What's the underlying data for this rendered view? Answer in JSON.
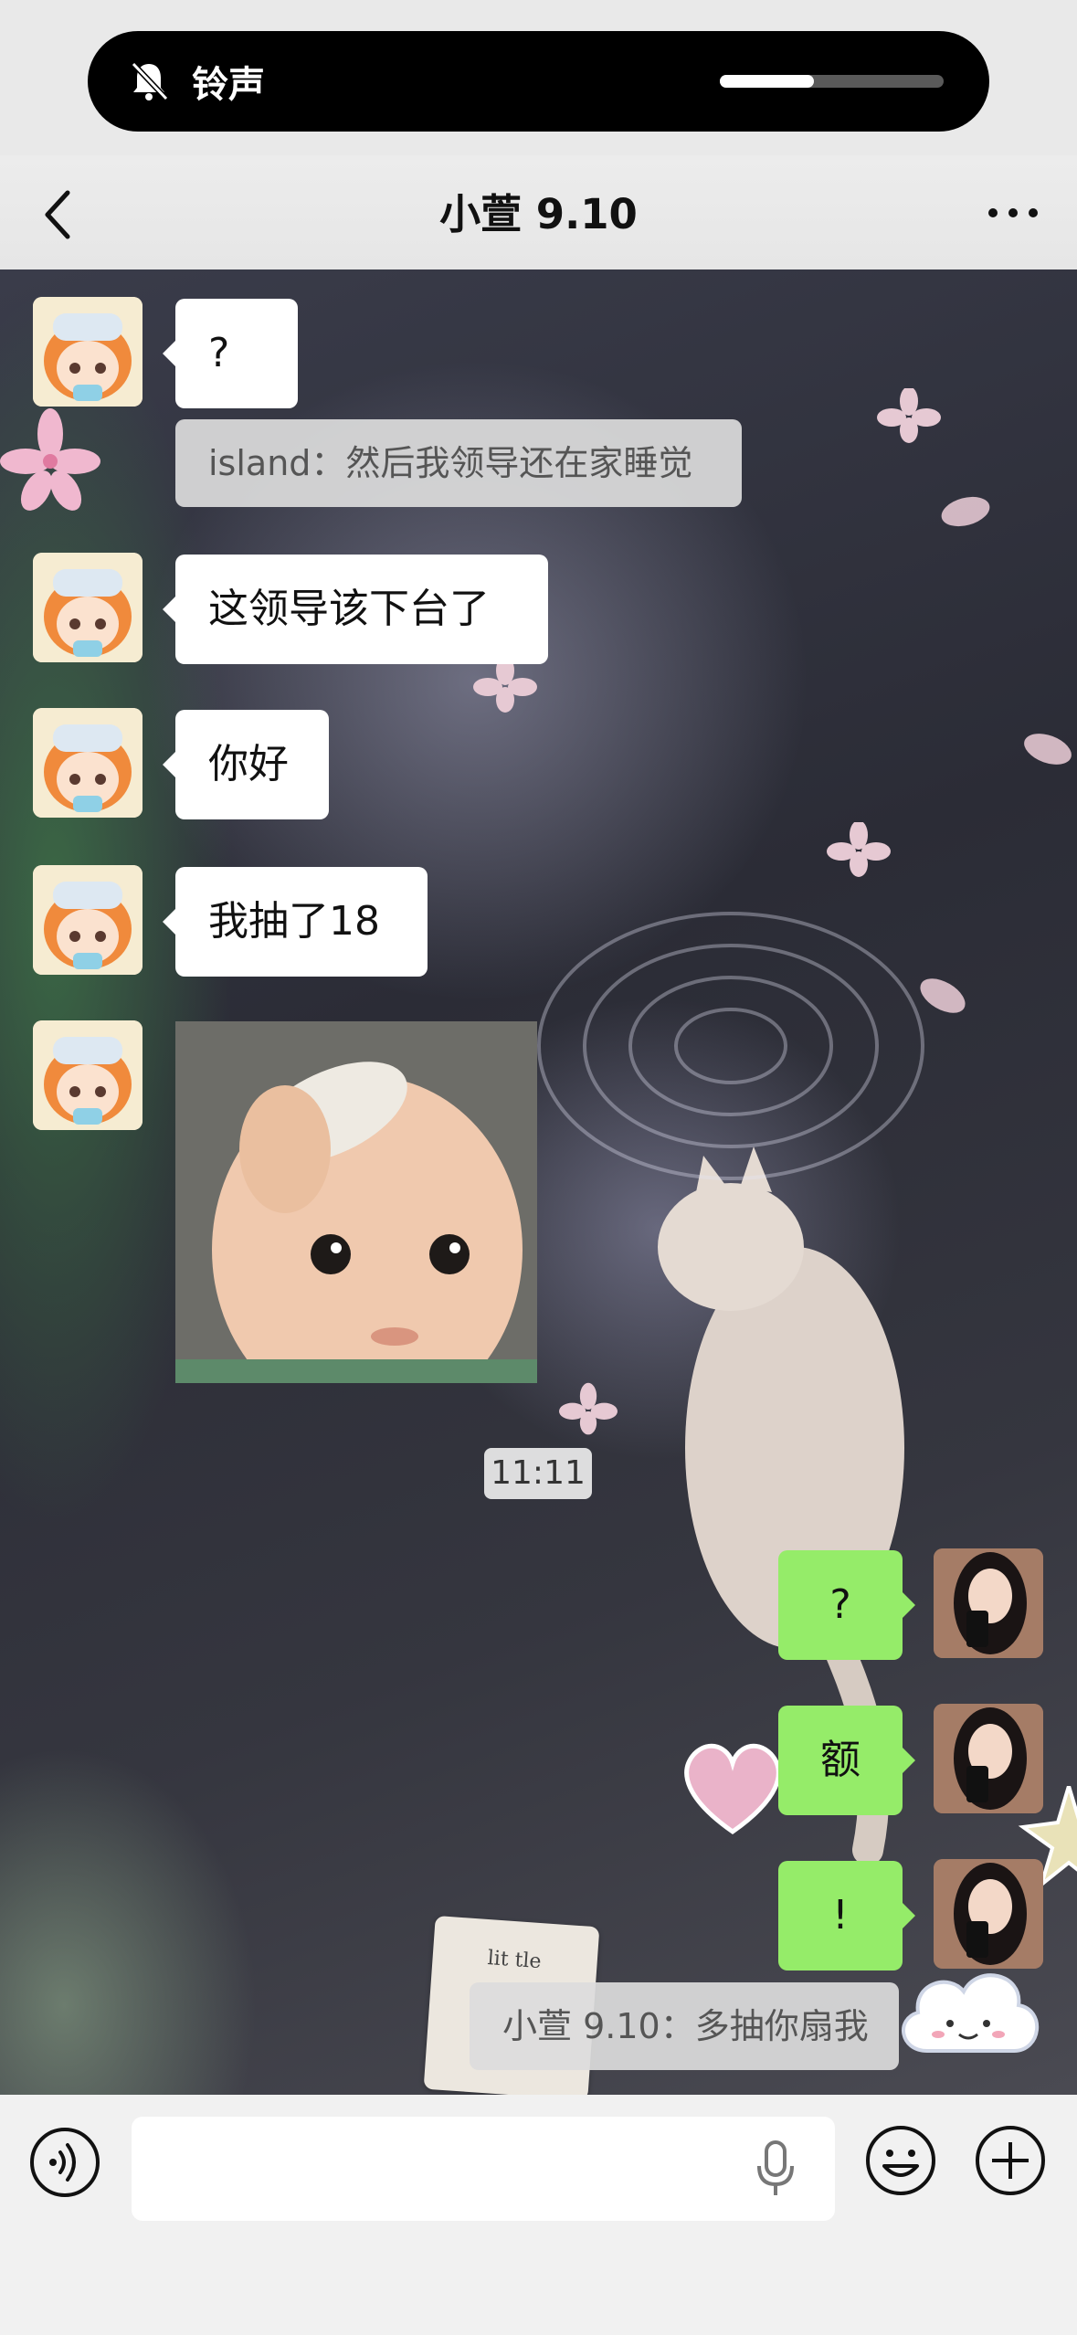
{
  "ringer": {
    "label": "铃声",
    "volume_fraction": 0.42,
    "icon": "bell-muted-icon"
  },
  "header": {
    "title": "小萱 9.10",
    "back_icon": "chevron-left-icon",
    "more_icon": "more-horizontal-icon"
  },
  "messages": [
    {
      "side": "left",
      "type": "text",
      "text": "?"
    },
    {
      "type": "quote",
      "text": "island：然后我领导还在家睡觉"
    },
    {
      "side": "left",
      "type": "text",
      "text": "这领导该下台了"
    },
    {
      "side": "left",
      "type": "text",
      "text": "你好"
    },
    {
      "side": "left",
      "type": "text",
      "text": "我抽了18"
    },
    {
      "side": "left",
      "type": "image",
      "alt": "baby-photo"
    },
    {
      "type": "time",
      "text": "11:11"
    },
    {
      "side": "right",
      "type": "text",
      "text": "?"
    },
    {
      "side": "right",
      "type": "text",
      "text": "额"
    },
    {
      "side": "right",
      "type": "text",
      "text": "!"
    },
    {
      "type": "quote",
      "text": "小萱 9.10：多抽你扇我"
    }
  ],
  "sticker_text": "lit tle",
  "input": {
    "value": "",
    "placeholder": ""
  },
  "toolbar": {
    "voice_icon": "voice-input-icon",
    "mic_icon": "microphone-icon",
    "emoji_icon": "emoji-icon",
    "plus_icon": "plus-icon"
  },
  "colors": {
    "bubble_self": "#95ec69",
    "bubble_other": "#ffffff",
    "header_bg": "#ececec"
  }
}
